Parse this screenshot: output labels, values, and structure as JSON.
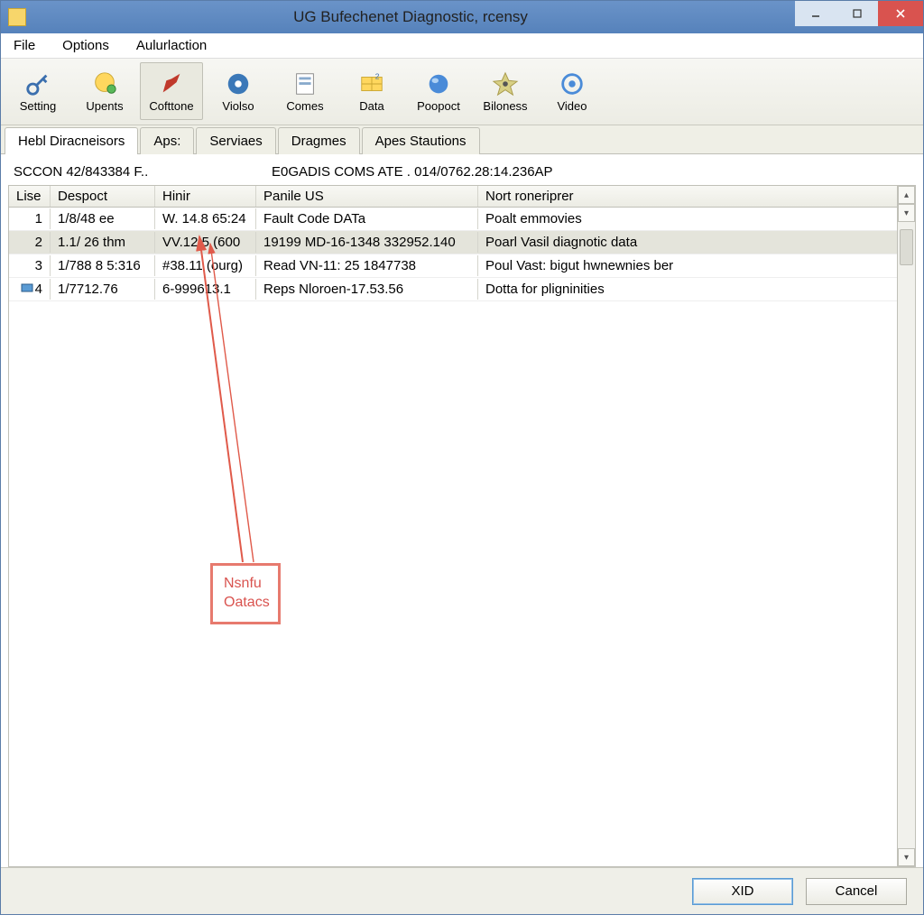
{
  "window": {
    "title": "UG Bufechenet Diagnostic, rcensy"
  },
  "menu": {
    "file": "File",
    "options": "Options",
    "aulurlaction": "Aulurlaction"
  },
  "toolbar": [
    {
      "label": "Setting",
      "icon": "key-icon"
    },
    {
      "label": "Upents",
      "icon": "globe-icon"
    },
    {
      "label": "Cofttone",
      "icon": "pen-icon",
      "active": true
    },
    {
      "label": "Violso",
      "icon": "disc-icon"
    },
    {
      "label": "Comes",
      "icon": "form-icon"
    },
    {
      "label": "Data",
      "icon": "table-icon"
    },
    {
      "label": "Poopoct",
      "icon": "ball-icon"
    },
    {
      "label": "Biloness",
      "icon": "star-icon"
    },
    {
      "label": "Video",
      "icon": "lens-icon"
    }
  ],
  "tabs": [
    {
      "label": "Hebl Diracneisors",
      "active": true
    },
    {
      "label": "Aps:",
      "active": false
    },
    {
      "label": "Serviaes",
      "active": false
    },
    {
      "label": "Dragmes",
      "active": false
    },
    {
      "label": "Apes Stautions",
      "active": false
    }
  ],
  "status": {
    "left": "SCCON 42/843384 F..",
    "right": "E0GADIS COMS ATE . 014/0762.28:14.236AP"
  },
  "table": {
    "columns": {
      "lise": "Lise",
      "despoct": "Despoct",
      "hinir": "Hinir",
      "panile": "Panile US",
      "nort": "Nort roneriprer"
    },
    "rows": [
      {
        "lise": "1",
        "despoct": "1/8/48 ee",
        "hinir": "W. 14.8 65:24",
        "panile": "Fault Code DATa",
        "nort": "Poalt emmovies",
        "selected": false
      },
      {
        "lise": "2",
        "despoct": "1.1/ 26 thm",
        "hinir": "VV.12.5 (600",
        "panile": "19199 MD-16-1348 332952.140",
        "nort": "Poarl Vasil diagnotic data",
        "selected": true
      },
      {
        "lise": "3",
        "despoct": "1/788 8 5:316",
        "hinir": "#38.11 (ourg)",
        "panile": "Read VN-11: 25 1847738",
        "nort": "Poul Vast: bigut hwnewnies ber",
        "selected": false
      },
      {
        "lise": "4",
        "despoct": "1/7712.76",
        "hinir": "6-999613.1",
        "panile": "Reps Nloroen-17.53.56",
        "nort": "Dotta for pligninities",
        "selected": false,
        "icon": true
      }
    ]
  },
  "callout": {
    "line1": "Nsnfu",
    "line2": "Oatacs"
  },
  "buttons": {
    "primary": "XID",
    "cancel": "Cancel"
  }
}
